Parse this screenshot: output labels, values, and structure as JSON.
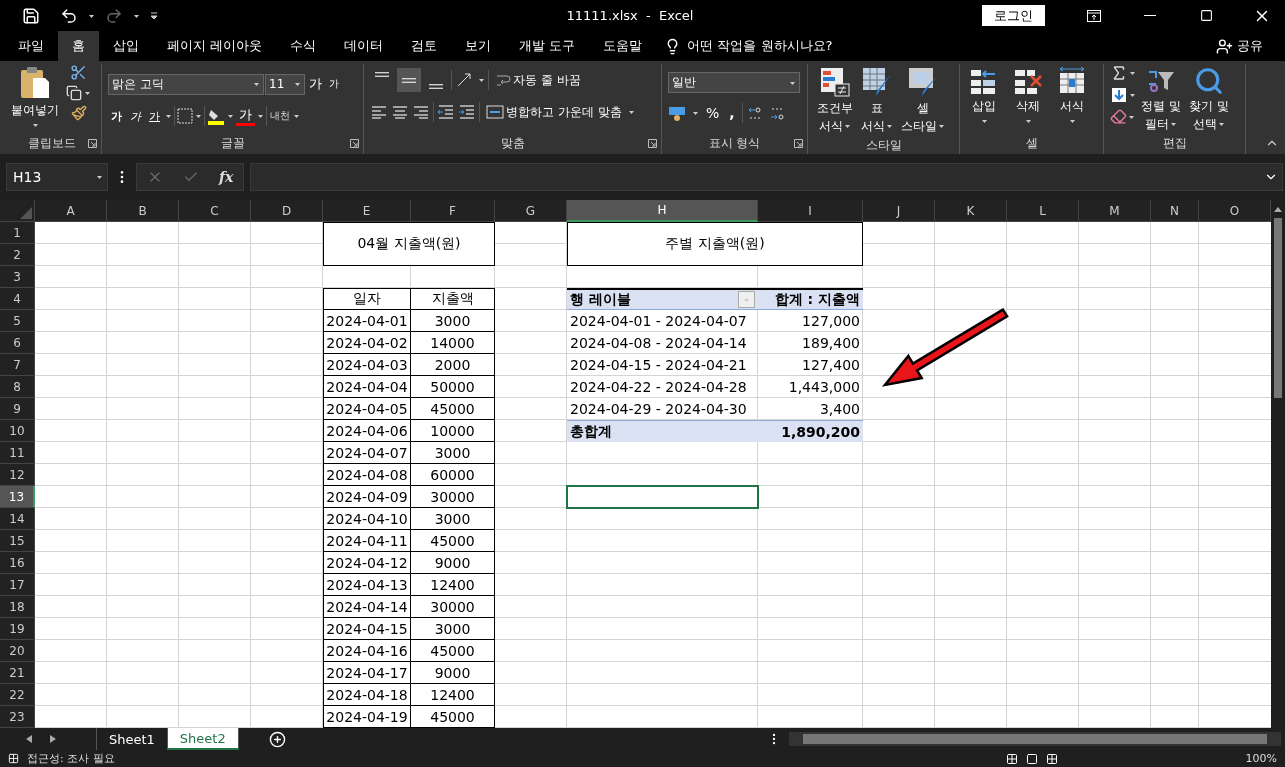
{
  "title_bar": {
    "title": "11111.xlsx  -  Excel",
    "login_button": "로그인"
  },
  "menu_tabs": [
    {
      "label": "파일",
      "selected": false
    },
    {
      "label": "홈",
      "selected": true
    },
    {
      "label": "삽입",
      "selected": false
    },
    {
      "label": "페이지 레이아웃",
      "selected": false
    },
    {
      "label": "수식",
      "selected": false
    },
    {
      "label": "데이터",
      "selected": false
    },
    {
      "label": "검토",
      "selected": false
    },
    {
      "label": "보기",
      "selected": false
    },
    {
      "label": "개발 도구",
      "selected": false
    },
    {
      "label": "도움말",
      "selected": false
    }
  ],
  "tell_me": "어떤 작업을 원하시나요?",
  "share": "공유",
  "ribbon": {
    "clipboard": {
      "title": "클립보드",
      "paste": "붙여넣기"
    },
    "font": {
      "title": "글꼴",
      "font_name": "맑은 고딕",
      "font_size": "11",
      "grow": "가",
      "shrink": "가",
      "bold": "가",
      "italic": "가",
      "underline": "가",
      "font_color": "가",
      "phonetic": "내천"
    },
    "alignment": {
      "title": "맞춤",
      "vertical_align": [
        {
          "selected": false
        },
        {
          "selected": true
        },
        {
          "selected": false
        }
      ],
      "wrap_text": "자동 줄 바꿈",
      "merge_center": "병합하고 가운데 맞춤"
    },
    "number": {
      "title": "표시 형식",
      "format": "일반",
      "percent": "%",
      "comma": ","
    },
    "styles": {
      "title": "스타일",
      "buttons": [
        {
          "kind": "conditional",
          "line1": "조건부",
          "line2": "서식"
        },
        {
          "kind": "table",
          "line1": "표",
          "line2": "서식"
        },
        {
          "kind": "cell",
          "line1": "셀",
          "line2": "스타일"
        }
      ]
    },
    "cells": {
      "title": "셀",
      "buttons": [
        {
          "kind": "insert",
          "label": "삽입"
        },
        {
          "kind": "delete",
          "label": "삭제"
        },
        {
          "kind": "format",
          "label": "서식"
        }
      ]
    },
    "editing": {
      "title": "편집",
      "buttons": [
        {
          "kind": "sort",
          "line1": "정렬 및",
          "line2": "필터"
        },
        {
          "kind": "find",
          "line1": "찾기 및",
          "line2": "선택"
        }
      ]
    }
  },
  "formula_bar": {
    "name_box": "H13",
    "function_label": "fx"
  },
  "sheet": {
    "columns": [
      {
        "label": "A",
        "selected": false
      },
      {
        "label": "B",
        "selected": false
      },
      {
        "label": "C",
        "selected": false
      },
      {
        "label": "D",
        "selected": false
      },
      {
        "label": "E",
        "selected": false
      },
      {
        "label": "F",
        "selected": false
      },
      {
        "label": "G",
        "selected": false
      },
      {
        "label": "H",
        "selected": true
      },
      {
        "label": "I",
        "selected": false
      },
      {
        "label": "J",
        "selected": false
      },
      {
        "label": "K",
        "selected": false
      },
      {
        "label": "L",
        "selected": false
      },
      {
        "label": "M",
        "selected": false
      },
      {
        "label": "N",
        "selected": false
      },
      {
        "label": "O",
        "selected": false
      }
    ],
    "rows": [
      {
        "label": "1",
        "selected": false
      },
      {
        "label": "2",
        "selected": false
      },
      {
        "label": "3",
        "selected": false
      },
      {
        "label": "4",
        "selected": false
      },
      {
        "label": "5",
        "selected": false
      },
      {
        "label": "6",
        "selected": false
      },
      {
        "label": "7",
        "selected": false
      },
      {
        "label": "8",
        "selected": false
      },
      {
        "label": "9",
        "selected": false
      },
      {
        "label": "10",
        "selected": false
      },
      {
        "label": "11",
        "selected": false
      },
      {
        "label": "12",
        "selected": false
      },
      {
        "label": "13",
        "selected": true
      },
      {
        "label": "14",
        "selected": false
      },
      {
        "label": "15",
        "selected": false
      },
      {
        "label": "16",
        "selected": false
      },
      {
        "label": "17",
        "selected": false
      },
      {
        "label": "18",
        "selected": false
      },
      {
        "label": "19",
        "selected": false
      },
      {
        "label": "20",
        "selected": false
      },
      {
        "label": "21",
        "selected": false
      },
      {
        "label": "22",
        "selected": false
      },
      {
        "label": "23",
        "selected": false
      }
    ],
    "expense_table": {
      "title": "04월 지출액(원)",
      "headers": [
        "일자",
        "지출액"
      ],
      "rows": [
        [
          "2024-04-01",
          "3000"
        ],
        [
          "2024-04-02",
          "14000"
        ],
        [
          "2024-04-03",
          "2000"
        ],
        [
          "2024-04-04",
          "50000"
        ],
        [
          "2024-04-05",
          "45000"
        ],
        [
          "2024-04-06",
          "10000"
        ],
        [
          "2024-04-07",
          "3000"
        ],
        [
          "2024-04-08",
          "60000"
        ],
        [
          "2024-04-09",
          "30000"
        ],
        [
          "2024-04-10",
          "3000"
        ],
        [
          "2024-04-11",
          "45000"
        ],
        [
          "2024-04-12",
          "9000"
        ],
        [
          "2024-04-13",
          "12400"
        ],
        [
          "2024-04-14",
          "30000"
        ],
        [
          "2024-04-15",
          "3000"
        ],
        [
          "2024-04-16",
          "45000"
        ],
        [
          "2024-04-17",
          "9000"
        ],
        [
          "2024-04-18",
          "12400"
        ],
        [
          "2024-04-19",
          "45000"
        ]
      ]
    },
    "pivot_table": {
      "title": "주별 지출액(원)",
      "header_label": "행 레이블",
      "header_value": "합계 : 지출액",
      "rows": [
        {
          "label": "2024-04-01 - 2024-04-07",
          "value": "127,000"
        },
        {
          "label": "2024-04-08 - 2024-04-14",
          "value": "189,400"
        },
        {
          "label": "2024-04-15 - 2024-04-21",
          "value": "127,400"
        },
        {
          "label": "2024-04-22 - 2024-04-28",
          "value": "1,443,000"
        },
        {
          "label": "2024-04-29 - 2024-04-30",
          "value": "3,400"
        }
      ],
      "total_label": "총합계",
      "total_value": "1,890,200"
    }
  },
  "sheet_tabs": [
    {
      "label": "Sheet1",
      "selected": false
    },
    {
      "label": "Sheet2",
      "selected": true
    }
  ],
  "status_bar": {
    "text": "접근성: 조사 필요",
    "zoom": "100%"
  }
}
